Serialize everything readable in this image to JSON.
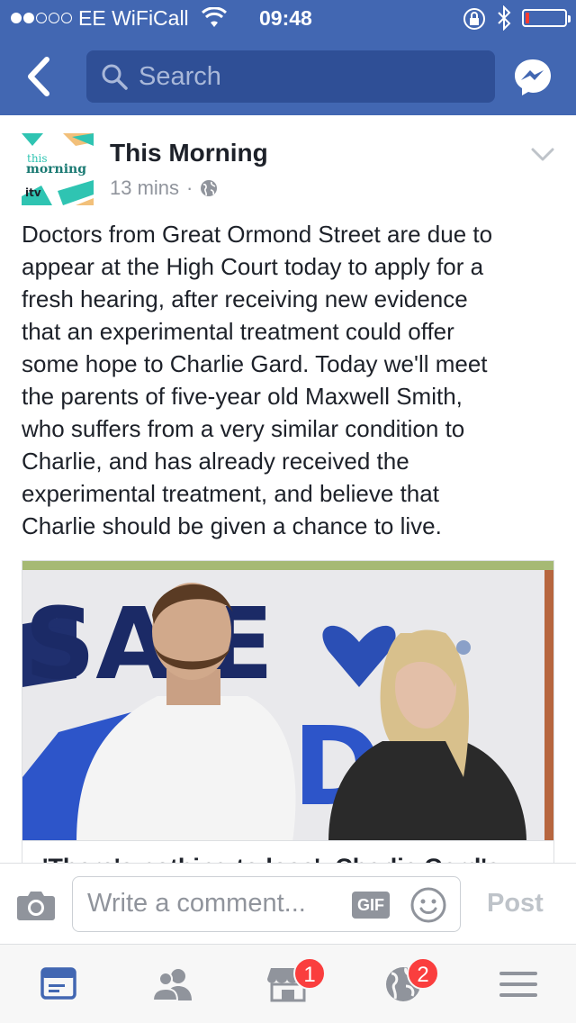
{
  "status_bar": {
    "carrier": "EE WiFiCall",
    "time": "09:48"
  },
  "nav": {
    "search_placeholder": "Search",
    "back_icon": "back-chevron-icon",
    "messenger_icon": "messenger-icon",
    "color": "#4267b2"
  },
  "post": {
    "page_name": "This Morning",
    "logo_text": "this morning",
    "logo_brand": "itv",
    "time_ago": "13 mins",
    "separator": "·",
    "privacy_icon": "globe-icon",
    "body": "Doctors from Great Ormond Street are due to\nappear at the High Court today to apply for a\nfresh hearing, after receiving new evidence\nthat an experimental treatment could offer\nsome hope to Charlie Gard. Today we'll meet\nthe parents of five-year old Maxwell Smith,\nwho suffers from a very similar condition to\nCharlie, and has already received the\nexperimental treatment, and believe that\nCharlie should be given a chance to live.",
    "link_title": "'There's nothing to lose': Charlie Gard's"
  },
  "comment_bar": {
    "placeholder": "Write a comment...",
    "gif_label": "GIF",
    "post_label": "Post"
  },
  "tabs": [
    {
      "name": "news-feed",
      "icon": "news-feed-icon",
      "badge": ""
    },
    {
      "name": "friends",
      "icon": "friends-icon",
      "badge": ""
    },
    {
      "name": "marketplace",
      "icon": "marketplace-icon",
      "badge": "1"
    },
    {
      "name": "notifications",
      "icon": "globe-icon",
      "badge": "2"
    },
    {
      "name": "menu",
      "icon": "menu-icon",
      "badge": ""
    }
  ]
}
